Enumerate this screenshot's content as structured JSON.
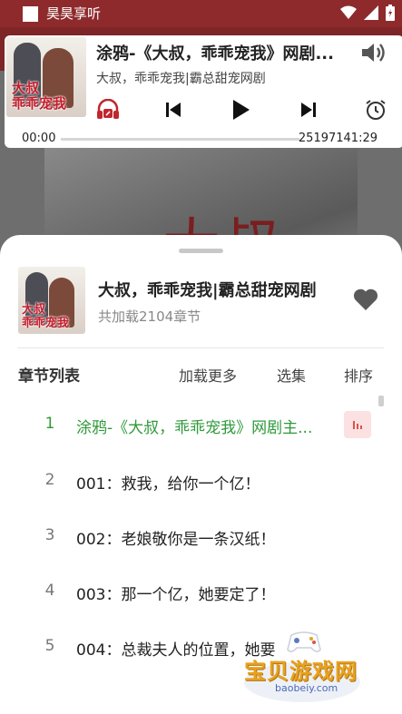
{
  "status_bar": {
    "app_name": "昊昊享听"
  },
  "player": {
    "title": "涂鸦-《大叔，乖乖宠我》网剧...",
    "subtitle": "大叔，乖乖宠我|霸总甜宠网剧",
    "current_time": "00:00",
    "total_time": "25197141:29",
    "progress": 0,
    "accent_color": "#c0272d"
  },
  "cover": {
    "caption_line1": "大叔",
    "caption_line2": "乖乖宠我",
    "background_glyph": "大叔"
  },
  "album": {
    "title": "大叔，乖乖宠我|霸总甜宠网剧",
    "count": "共加载2104章节"
  },
  "chapter_list": {
    "header": "章节列表",
    "load_more": "加载更多",
    "select": "选集",
    "sort": "排序",
    "items": [
      {
        "num": "1",
        "title": "涂鸦-《大叔，乖乖宠我》网剧主...",
        "playing": true
      },
      {
        "num": "2",
        "title": "001：救我，给你一个亿！"
      },
      {
        "num": "3",
        "title": "002：老娘敬你是一条汉纸！"
      },
      {
        "num": "4",
        "title": "003：那一个亿，她要定了！"
      },
      {
        "num": "5",
        "title": "004：总裁夫人的位置，她要"
      }
    ]
  },
  "watermark": {
    "text": "宝贝游戏网",
    "url": "baobeiy.com"
  }
}
